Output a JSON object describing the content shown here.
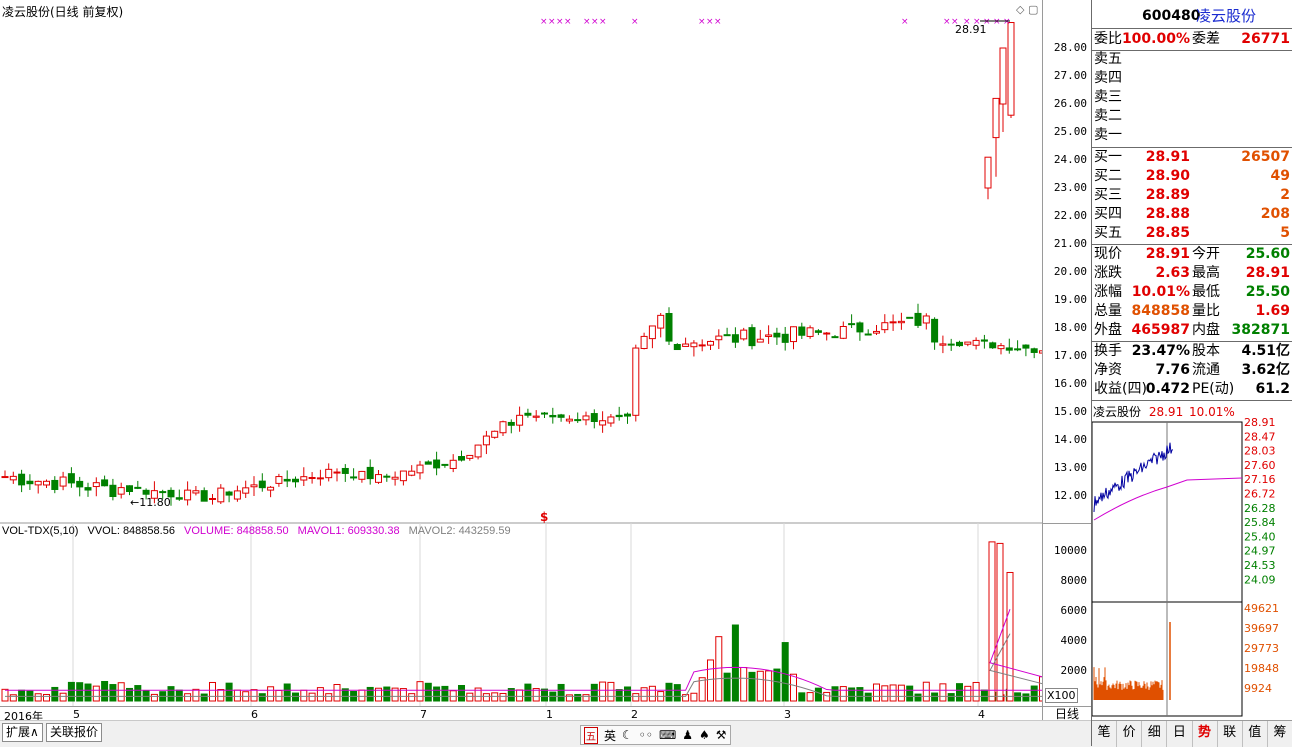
{
  "title": "凌云股份(日线 前复权)",
  "price_axis": [
    "28.00",
    "27.00",
    "26.00",
    "25.00",
    "24.00",
    "23.00",
    "22.00",
    "21.00",
    "20.00",
    "19.00",
    "18.00",
    "17.00",
    "16.00",
    "15.00",
    "14.00",
    "13.00",
    "12.00"
  ],
  "vol_axis": [
    "10000",
    "8000",
    "6000",
    "4000",
    "2000"
  ],
  "vol_unit": "X100",
  "vol_legend": {
    "name": "VOL-TDX(5,10)",
    "vvol": "VVOL: 848858.56",
    "volume": "VOLUME: 848858.50",
    "mavol1": "MAVOL1: 609330.38",
    "mavol2": "MAVOL2: 443259.59"
  },
  "annotations": {
    "high_label": "28.91",
    "low_label": "←11.80",
    "s_marker": "$"
  },
  "dates": [
    {
      "label": "2016年"
    },
    {
      "label": "5"
    },
    {
      "label": "6"
    },
    {
      "label": "7"
    },
    {
      "label": "1"
    },
    {
      "label": "2"
    },
    {
      "label": "3"
    },
    {
      "label": "4"
    }
  ],
  "period_button": "日线",
  "bottom_tabs": [
    "扩展∧",
    "关联报价"
  ],
  "ime": {
    "items": [
      "五",
      "英",
      "☾",
      "◦◦",
      "⌨",
      "♟",
      "♠",
      "⚒"
    ]
  },
  "quote": {
    "code": "600480",
    "name": "凌云股份",
    "weibi_label": "委比",
    "weibi": "100.00%",
    "weicha_label": "委差",
    "weicha": "26771",
    "sell": [
      {
        "label": "卖五"
      },
      {
        "label": "卖四"
      },
      {
        "label": "卖三"
      },
      {
        "label": "卖二"
      },
      {
        "label": "卖一"
      }
    ],
    "buy": [
      {
        "label": "买一",
        "price": "28.91",
        "vol": "26507"
      },
      {
        "label": "买二",
        "price": "28.90",
        "vol": "49"
      },
      {
        "label": "买三",
        "price": "28.89",
        "vol": "2"
      },
      {
        "label": "买四",
        "price": "28.88",
        "vol": "208"
      },
      {
        "label": "买五",
        "price": "28.85",
        "vol": "5"
      }
    ],
    "stats": [
      {
        "l1": "现价",
        "v1": "28.91",
        "l2": "今开",
        "v2": "25.60",
        "c1": "red",
        "c2": "green"
      },
      {
        "l1": "涨跌",
        "v1": "2.63",
        "l2": "最高",
        "v2": "28.91",
        "c1": "red",
        "c2": "red"
      },
      {
        "l1": "涨幅",
        "v1": "10.01%",
        "l2": "最低",
        "v2": "25.50",
        "c1": "red",
        "c2": "green"
      },
      {
        "l1": "总量",
        "v1": "848858",
        "l2": "量比",
        "v2": "1.69",
        "c1": "org",
        "c2": "red"
      },
      {
        "l1": "外盘",
        "v1": "465987",
        "l2": "内盘",
        "v2": "382871",
        "c1": "red",
        "c2": "green"
      }
    ],
    "fund": [
      {
        "l1": "换手",
        "v1": "23.47%",
        "l2": "股本",
        "v2": "4.51亿"
      },
      {
        "l1": "净资",
        "v1": "7.76",
        "l2": "流通",
        "v2": "3.62亿"
      },
      {
        "l1": "收益(四)",
        "v1": "0.472",
        "l2": "PE(动)",
        "v2": "61.2"
      }
    ]
  },
  "mini": {
    "name": "凌云股份",
    "price": "28.91",
    "pct": "10.01%",
    "price_axis": [
      "28.91",
      "28.47",
      "28.03",
      "27.60",
      "27.16",
      "26.72",
      "26.28",
      "25.84",
      "25.40",
      "24.97",
      "24.53",
      "24.09"
    ],
    "vol_axis": [
      "49621",
      "39697",
      "29773",
      "19848",
      "9924"
    ],
    "tabs": [
      "笔",
      "价",
      "细",
      "日",
      "势",
      "联",
      "值",
      "筹"
    ],
    "active_tab": "势"
  },
  "colors": {
    "up": "#e00000",
    "down": "#008000",
    "ma1": "#d000d0",
    "ma2": "#808080"
  }
}
